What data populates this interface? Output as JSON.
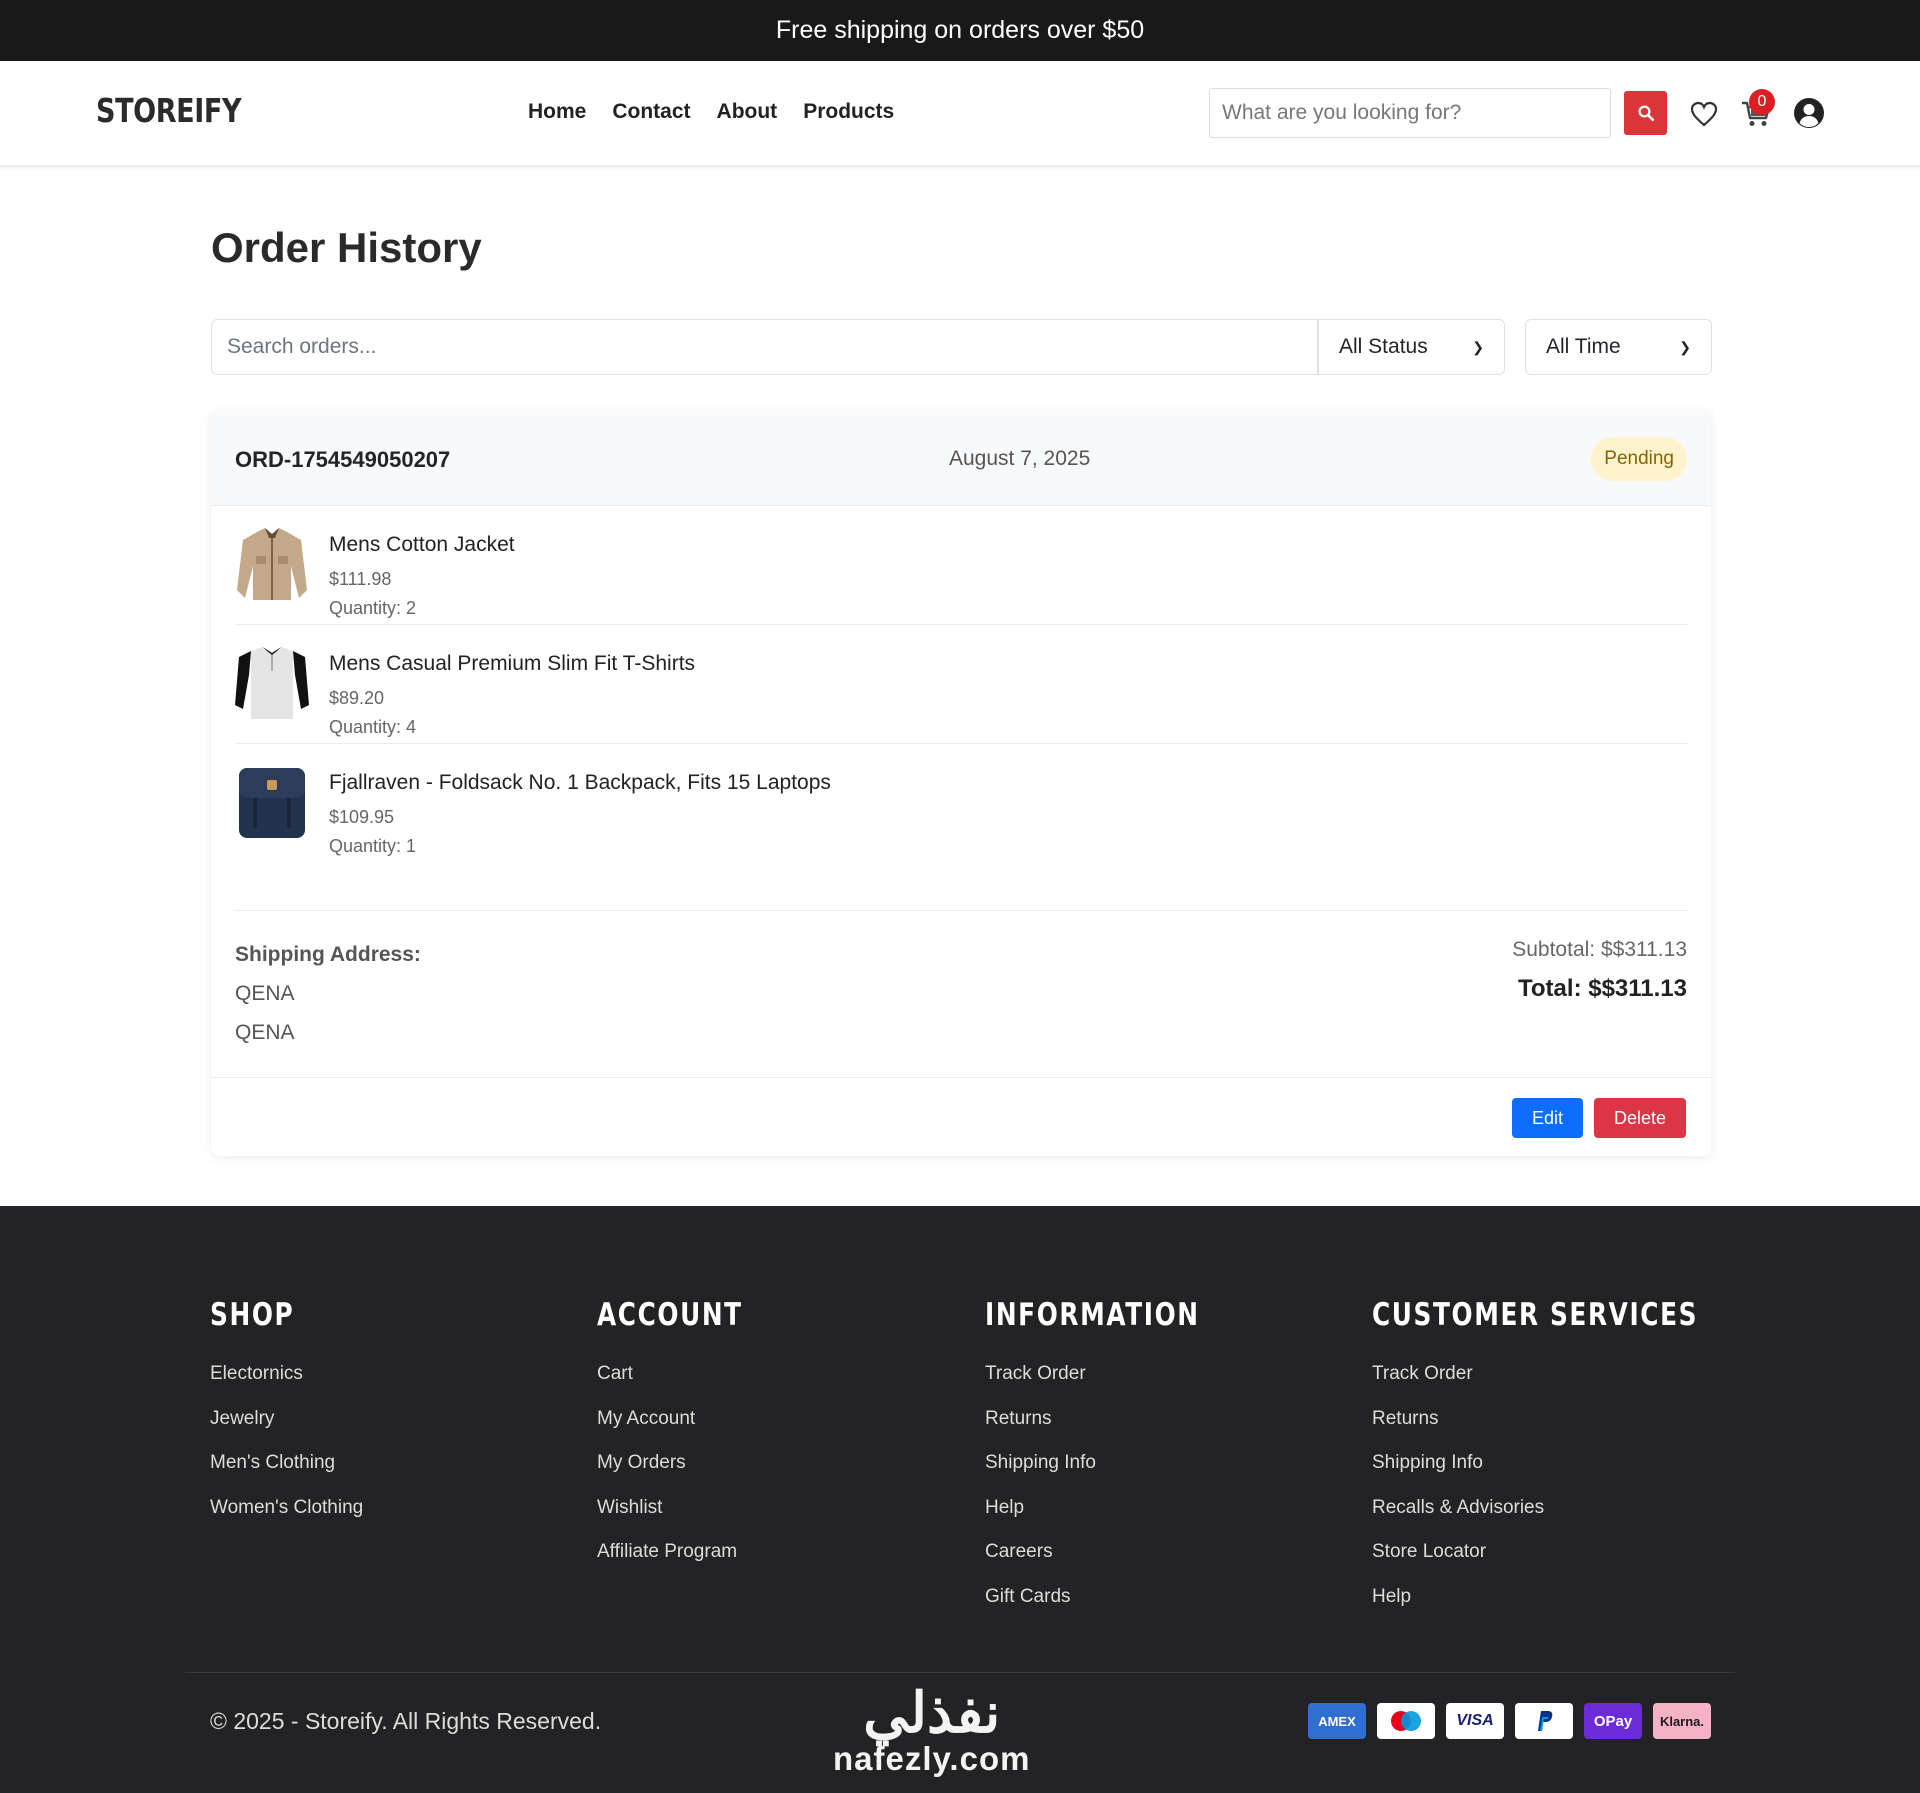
{
  "announcement": "Free shipping on orders over $50",
  "brand": "STOREIFY",
  "nav": [
    "Home",
    "Contact",
    "About",
    "Products"
  ],
  "search": {
    "placeholder": "What are you looking for?"
  },
  "cart_count": "0",
  "page_title": "Order History",
  "filters": {
    "search_placeholder": "Search orders...",
    "status_selected": "All Status",
    "time_selected": "All Time"
  },
  "order": {
    "id": "ORD-1754549050207",
    "date": "August 7, 2025",
    "status": "Pending",
    "status_color": "#fff3cd",
    "items": [
      {
        "name": "Mens Cotton Jacket",
        "price": "$111.98",
        "quantity": "Quantity: 2",
        "icon": "jacket-image"
      },
      {
        "name": "Mens Casual Premium Slim Fit T-Shirts",
        "price": "$89.20",
        "quantity": "Quantity: 4",
        "icon": "tshirt-image"
      },
      {
        "name": "Fjallraven - Foldsack No. 1 Backpack, Fits 15 Laptops",
        "price": "$109.95",
        "quantity": "Quantity: 1",
        "icon": "backpack-image"
      }
    ],
    "shipping_title": "Shipping Address:",
    "shipping_lines": [
      "QENA",
      "QENA"
    ],
    "subtotal": "Subtotal: $$311.13",
    "total": "Total: $$311.13",
    "edit_label": "Edit",
    "delete_label": "Delete"
  },
  "footer": {
    "columns": [
      {
        "title": "SHOP",
        "links": [
          "Electornics",
          "Jewelry",
          "Men's Clothing",
          "Women's Clothing"
        ]
      },
      {
        "title": "ACCOUNT",
        "links": [
          "Cart",
          "My Account",
          "My Orders",
          "Wishlist",
          "Affiliate Program"
        ]
      },
      {
        "title": "INFORMATION",
        "links": [
          "Track Order",
          "Returns",
          "Shipping Info",
          "Help",
          "Careers",
          "Gift Cards"
        ]
      },
      {
        "title": "CUSTOMER SERVICES",
        "links": [
          "Track Order",
          "Returns",
          "Shipping Info",
          "Recalls & Advisories",
          "Store Locator",
          "Help"
        ]
      }
    ],
    "copyright": "© 2025 - Storeify. All Rights Reserved.",
    "payments": [
      "AMEX",
      "Maestro",
      "VISA",
      "PayPal",
      "OPay",
      "Klarna."
    ],
    "watermark_ar": "نفذلي",
    "watermark_en": "nafezly.com"
  },
  "colors": {
    "accent_red": "#db3439",
    "edit_blue": "#0d6efd",
    "delete_red": "#dc3545",
    "footer_bg": "#232325",
    "topbar_bg": "#191919"
  }
}
